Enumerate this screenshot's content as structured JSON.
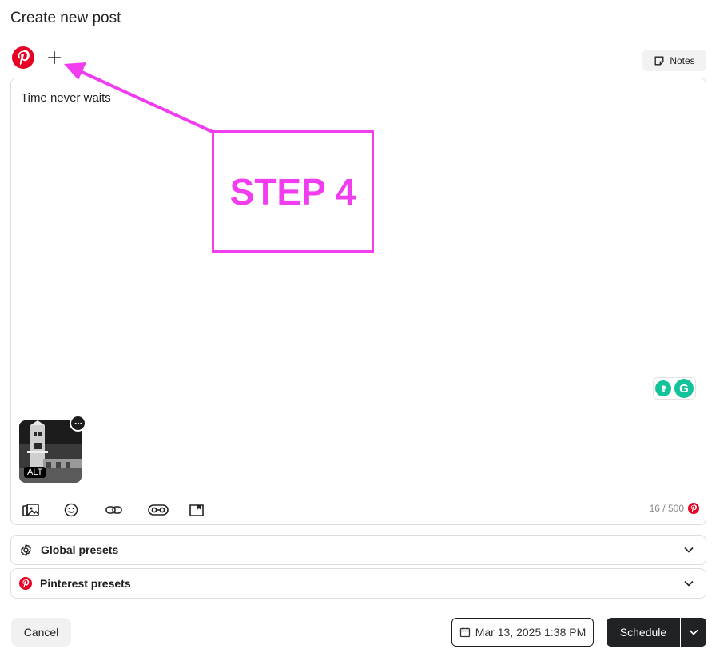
{
  "dialog": {
    "title": "Create new post"
  },
  "toolbar_top": {
    "notes_label": "Notes"
  },
  "editor": {
    "text": "Time never waits",
    "image_alt_badge": "ALT",
    "char_count": "16 / 500"
  },
  "presets": [
    {
      "label": "Global presets",
      "icon": "gear-icon"
    },
    {
      "label": "Pinterest presets",
      "icon": "pinterest-icon"
    }
  ],
  "footer": {
    "cancel_label": "Cancel",
    "date_label": "Mar 13, 2025 1:38 PM",
    "schedule_label": "Schedule"
  },
  "annotation": {
    "step_label": "STEP 4"
  },
  "colors": {
    "pinterest_red": "#e60023",
    "annotation_magenta": "#f13cf0",
    "grammarly_green": "#15c39a",
    "dark_button": "#1f2326"
  }
}
